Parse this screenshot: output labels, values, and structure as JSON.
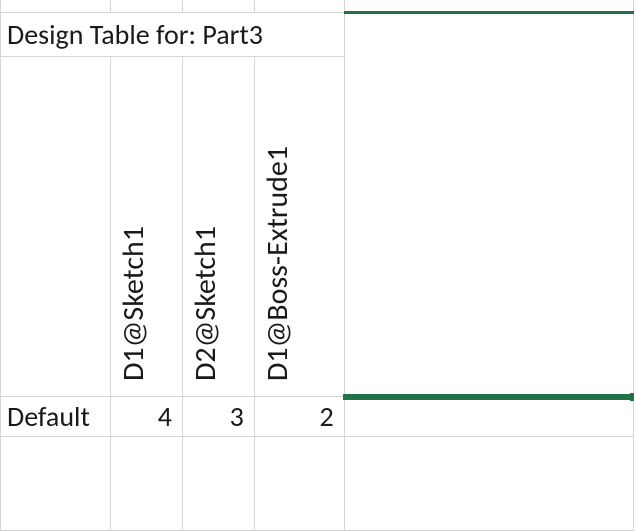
{
  "title": "Design Table for: Part3",
  "headers": {
    "col_b": "D1@Sketch1",
    "col_c": "D2@Sketch1",
    "col_d": "D1@Boss-Extrude1"
  },
  "rows": [
    {
      "label": "Default",
      "values": {
        "col_b": "4",
        "col_c": "3",
        "col_d": "2"
      }
    }
  ],
  "colors": {
    "selection": "#217346",
    "grid": "#d4d4d4"
  }
}
